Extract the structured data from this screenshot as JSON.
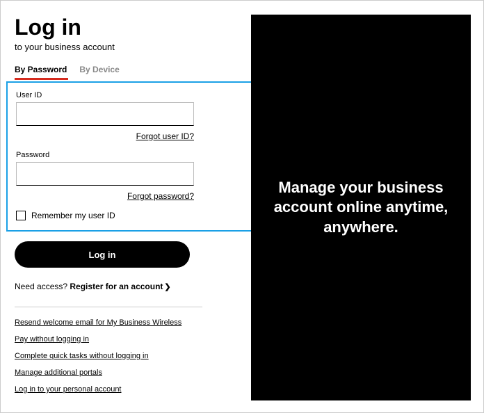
{
  "header": {
    "title": "Log in",
    "subtitle": "to your business account"
  },
  "tabs": {
    "password": "By Password",
    "device": "By Device"
  },
  "form": {
    "userid_label": "User ID",
    "userid_value": "",
    "forgot_userid": "Forgot user ID?",
    "password_label": "Password",
    "password_value": "",
    "forgot_password": "Forgot password?",
    "remember_label": "Remember my user ID",
    "login_button": "Log in"
  },
  "register": {
    "prompt": "Need access? ",
    "action": "Register for an account"
  },
  "help_links": [
    "Resend welcome email for My Business Wireless",
    "Pay without logging in",
    "Complete quick tasks without logging in",
    "Manage additional portals",
    "Log in to your personal account"
  ],
  "promo": {
    "text": "Manage your business account online anytime, anywhere."
  }
}
